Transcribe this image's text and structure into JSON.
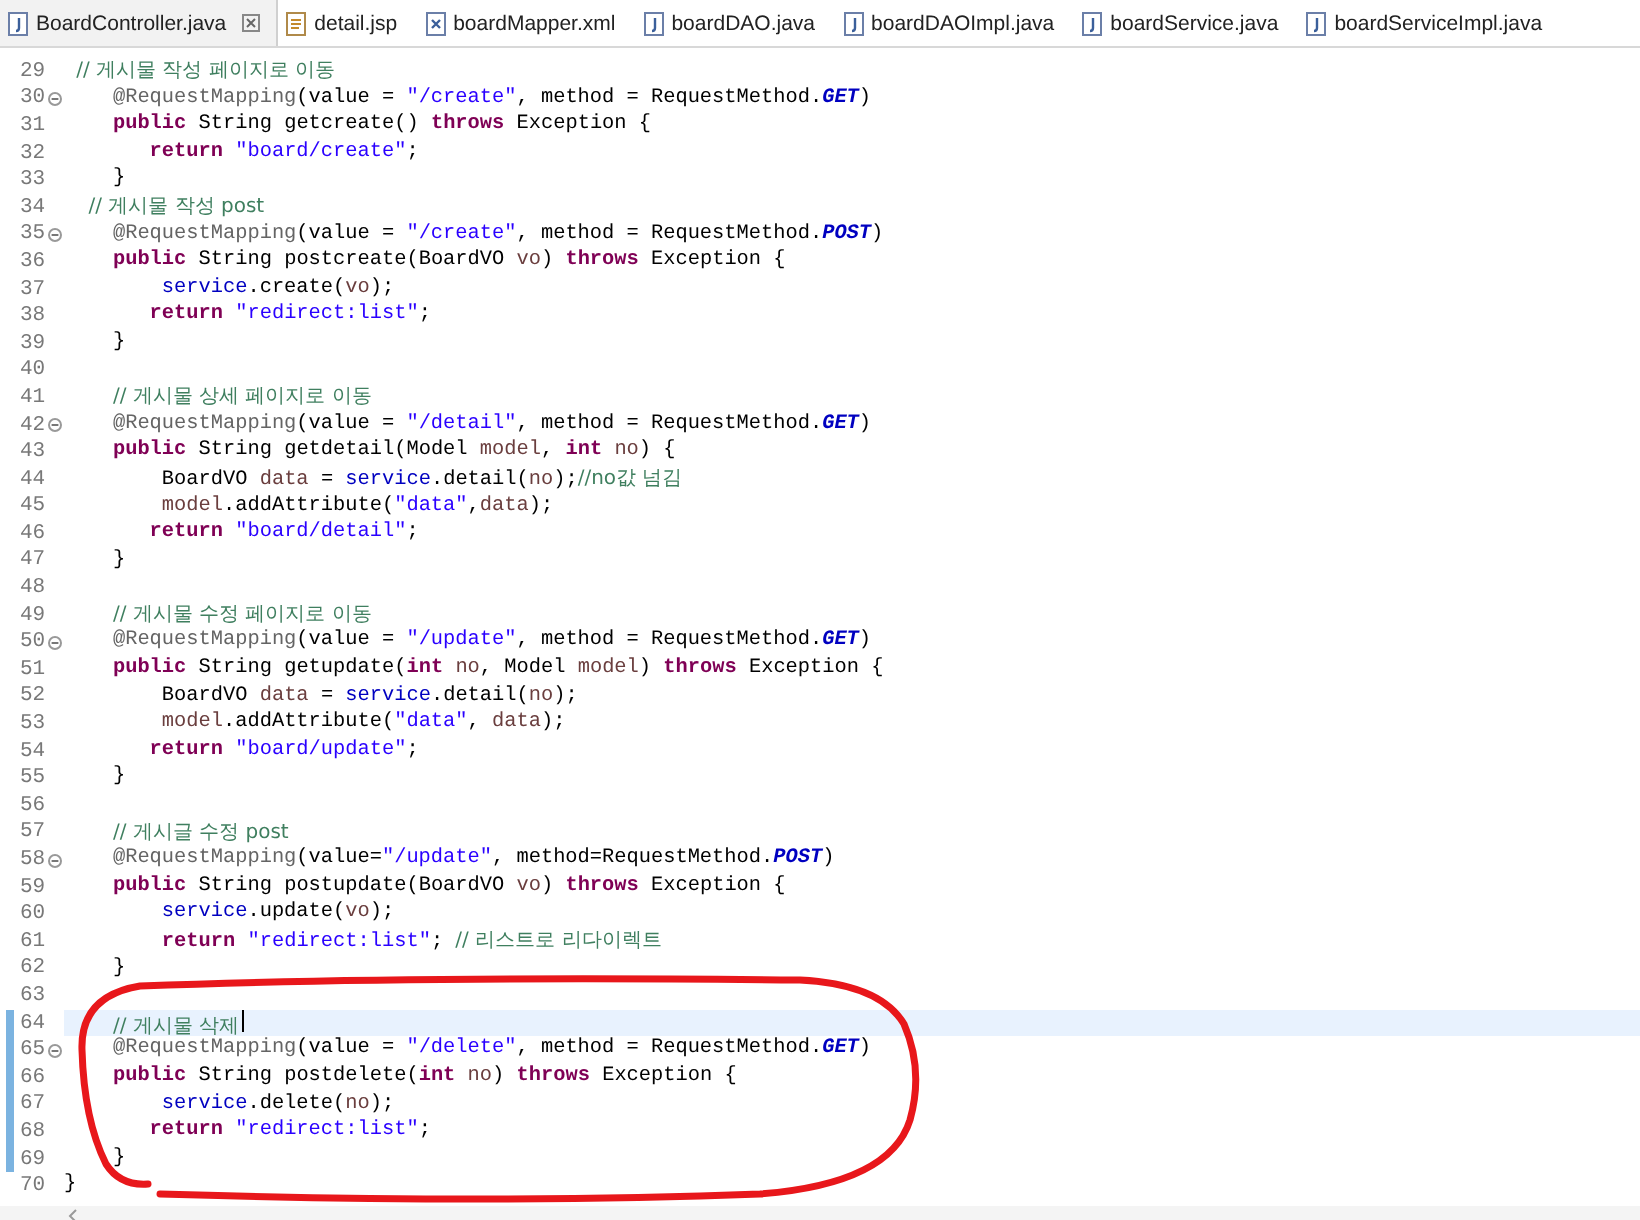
{
  "tabs": [
    {
      "label": "BoardController.java",
      "kind": "java",
      "selected": true
    },
    {
      "label": "detail.jsp",
      "kind": "jsp",
      "selected": false
    },
    {
      "label": "boardMapper.xml",
      "kind": "xml",
      "selected": false
    },
    {
      "label": "boardDAO.java",
      "kind": "java",
      "selected": false
    },
    {
      "label": "boardDAOImpl.java",
      "kind": "java",
      "selected": false
    },
    {
      "label": "boardService.java",
      "kind": "java",
      "selected": false
    },
    {
      "label": "boardServiceImpl.java",
      "kind": "java",
      "selected": false
    }
  ],
  "lines": [
    {
      "number": "29",
      "fold": false,
      "changed": false,
      "current": false,
      "tokens": [
        {
          "kind": "comment",
          "text": " // 게시물 작성 페이지로 이동"
        }
      ]
    },
    {
      "number": "30",
      "fold": true,
      "changed": false,
      "current": false,
      "tokens": [
        {
          "kind": "annotation",
          "text": "    @RequestMapping"
        },
        {
          "kind": "plain",
          "text": "(value = "
        },
        {
          "kind": "string",
          "text": "\"/create\""
        },
        {
          "kind": "plain",
          "text": ", method = RequestMethod."
        },
        {
          "kind": "constant",
          "text": "GET"
        },
        {
          "kind": "plain",
          "text": ")"
        }
      ]
    },
    {
      "number": "31",
      "fold": false,
      "changed": false,
      "current": false,
      "tokens": [
        {
          "kind": "keyword",
          "text": "    public"
        },
        {
          "kind": "plain",
          "text": " String getcreate() "
        },
        {
          "kind": "keyword",
          "text": "throws"
        },
        {
          "kind": "plain",
          "text": " Exception {"
        }
      ]
    },
    {
      "number": "32",
      "fold": false,
      "changed": false,
      "current": false,
      "tokens": [
        {
          "kind": "keyword",
          "text": "       return"
        },
        {
          "kind": "string",
          "text": " \"board/create\""
        },
        {
          "kind": "plain",
          "text": ";"
        }
      ]
    },
    {
      "number": "33",
      "fold": false,
      "changed": false,
      "current": false,
      "tokens": [
        {
          "kind": "plain",
          "text": "    }"
        }
      ]
    },
    {
      "number": "34",
      "fold": false,
      "changed": false,
      "current": false,
      "tokens": [
        {
          "kind": "comment",
          "text": "  // 게시물 작성 post"
        }
      ]
    },
    {
      "number": "35",
      "fold": true,
      "changed": false,
      "current": false,
      "tokens": [
        {
          "kind": "annotation",
          "text": "    @RequestMapping"
        },
        {
          "kind": "plain",
          "text": "(value = "
        },
        {
          "kind": "string",
          "text": "\"/create\""
        },
        {
          "kind": "plain",
          "text": ", method = RequestMethod."
        },
        {
          "kind": "constant",
          "text": "POST"
        },
        {
          "kind": "plain",
          "text": ")"
        }
      ]
    },
    {
      "number": "36",
      "fold": false,
      "changed": false,
      "current": false,
      "tokens": [
        {
          "kind": "keyword",
          "text": "    public"
        },
        {
          "kind": "plain",
          "text": " String postcreate(BoardVO "
        },
        {
          "kind": "variable",
          "text": "vo"
        },
        {
          "kind": "plain",
          "text": ") "
        },
        {
          "kind": "keyword",
          "text": "throws"
        },
        {
          "kind": "plain",
          "text": " Exception {"
        }
      ]
    },
    {
      "number": "37",
      "fold": false,
      "changed": false,
      "current": false,
      "tokens": [
        {
          "kind": "field",
          "text": "        service"
        },
        {
          "kind": "plain",
          "text": ".create("
        },
        {
          "kind": "variable",
          "text": "vo"
        },
        {
          "kind": "plain",
          "text": ");"
        }
      ]
    },
    {
      "number": "38",
      "fold": false,
      "changed": false,
      "current": false,
      "tokens": [
        {
          "kind": "keyword",
          "text": "       return"
        },
        {
          "kind": "string",
          "text": " \"redirect:list\""
        },
        {
          "kind": "plain",
          "text": ";"
        }
      ]
    },
    {
      "number": "39",
      "fold": false,
      "changed": false,
      "current": false,
      "tokens": [
        {
          "kind": "plain",
          "text": "    }"
        }
      ]
    },
    {
      "number": "40",
      "fold": false,
      "changed": false,
      "current": false
    },
    {
      "number": "41",
      "fold": false,
      "changed": false,
      "current": false,
      "tokens": [
        {
          "kind": "comment",
          "text": "    // 게시물 상세 페이지로 이동"
        }
      ]
    },
    {
      "number": "42",
      "fold": true,
      "changed": false,
      "current": false,
      "tokens": [
        {
          "kind": "annotation",
          "text": "    @RequestMapping"
        },
        {
          "kind": "plain",
          "text": "(value = "
        },
        {
          "kind": "string",
          "text": "\"/detail\""
        },
        {
          "kind": "plain",
          "text": ", method = RequestMethod."
        },
        {
          "kind": "constant",
          "text": "GET"
        },
        {
          "kind": "plain",
          "text": ")"
        }
      ]
    },
    {
      "number": "43",
      "fold": false,
      "changed": false,
      "current": false,
      "tokens": [
        {
          "kind": "keyword",
          "text": "    public"
        },
        {
          "kind": "plain",
          "text": " String getdetail(Model "
        },
        {
          "kind": "variable",
          "text": "model"
        },
        {
          "kind": "plain",
          "text": ", "
        },
        {
          "kind": "keyword",
          "text": "int"
        },
        {
          "kind": "variable",
          "text": " no"
        },
        {
          "kind": "plain",
          "text": ") {"
        }
      ]
    },
    {
      "number": "44",
      "fold": false,
      "changed": false,
      "current": false,
      "tokens": [
        {
          "kind": "plain",
          "text": "        BoardVO "
        },
        {
          "kind": "variable",
          "text": "data"
        },
        {
          "kind": "plain",
          "text": " = "
        },
        {
          "kind": "field",
          "text": "service"
        },
        {
          "kind": "plain",
          "text": ".detail("
        },
        {
          "kind": "variable",
          "text": "no"
        },
        {
          "kind": "plain",
          "text": ");"
        },
        {
          "kind": "comment",
          "text": "//no값 넘김"
        }
      ]
    },
    {
      "number": "45",
      "fold": false,
      "changed": false,
      "current": false,
      "tokens": [
        {
          "kind": "variable",
          "text": "        model"
        },
        {
          "kind": "plain",
          "text": ".addAttribute("
        },
        {
          "kind": "string",
          "text": "\"data\""
        },
        {
          "kind": "plain",
          "text": ","
        },
        {
          "kind": "variable",
          "text": "data"
        },
        {
          "kind": "plain",
          "text": ");"
        }
      ]
    },
    {
      "number": "46",
      "fold": false,
      "changed": false,
      "current": false,
      "tokens": [
        {
          "kind": "keyword",
          "text": "       return"
        },
        {
          "kind": "string",
          "text": " \"board/detail\""
        },
        {
          "kind": "plain",
          "text": ";"
        }
      ]
    },
    {
      "number": "47",
      "fold": false,
      "changed": false,
      "current": false,
      "tokens": [
        {
          "kind": "plain",
          "text": "    }"
        }
      ]
    },
    {
      "number": "48",
      "fold": false,
      "changed": false,
      "current": false
    },
    {
      "number": "49",
      "fold": false,
      "changed": false,
      "current": false,
      "tokens": [
        {
          "kind": "comment",
          "text": "    // 게시물 수정 페이지로 이동"
        }
      ]
    },
    {
      "number": "50",
      "fold": true,
      "changed": false,
      "current": false,
      "tokens": [
        {
          "kind": "annotation",
          "text": "    @RequestMapping"
        },
        {
          "kind": "plain",
          "text": "(value = "
        },
        {
          "kind": "string",
          "text": "\"/update\""
        },
        {
          "kind": "plain",
          "text": ", method = RequestMethod."
        },
        {
          "kind": "constant",
          "text": "GET"
        },
        {
          "kind": "plain",
          "text": ")"
        }
      ]
    },
    {
      "number": "51",
      "fold": false,
      "changed": false,
      "current": false,
      "tokens": [
        {
          "kind": "keyword",
          "text": "    public"
        },
        {
          "kind": "plain",
          "text": " String getupdate("
        },
        {
          "kind": "keyword",
          "text": "int"
        },
        {
          "kind": "variable",
          "text": " no"
        },
        {
          "kind": "plain",
          "text": ", Model "
        },
        {
          "kind": "variable",
          "text": "model"
        },
        {
          "kind": "plain",
          "text": ") "
        },
        {
          "kind": "keyword",
          "text": "throws"
        },
        {
          "kind": "plain",
          "text": " Exception {"
        }
      ]
    },
    {
      "number": "52",
      "fold": false,
      "changed": false,
      "current": false,
      "tokens": [
        {
          "kind": "plain",
          "text": "        BoardVO "
        },
        {
          "kind": "variable",
          "text": "data"
        },
        {
          "kind": "plain",
          "text": " = "
        },
        {
          "kind": "field",
          "text": "service"
        },
        {
          "kind": "plain",
          "text": ".detail("
        },
        {
          "kind": "variable",
          "text": "no"
        },
        {
          "kind": "plain",
          "text": ");"
        }
      ]
    },
    {
      "number": "53",
      "fold": false,
      "changed": false,
      "current": false,
      "tokens": [
        {
          "kind": "variable",
          "text": "        model"
        },
        {
          "kind": "plain",
          "text": ".addAttribute("
        },
        {
          "kind": "string",
          "text": "\"data\""
        },
        {
          "kind": "plain",
          "text": ", "
        },
        {
          "kind": "variable",
          "text": "data"
        },
        {
          "kind": "plain",
          "text": ");"
        }
      ]
    },
    {
      "number": "54",
      "fold": false,
      "changed": false,
      "current": false,
      "tokens": [
        {
          "kind": "keyword",
          "text": "       return"
        },
        {
          "kind": "string",
          "text": " \"board/update\""
        },
        {
          "kind": "plain",
          "text": ";"
        }
      ]
    },
    {
      "number": "55",
      "fold": false,
      "changed": false,
      "current": false,
      "tokens": [
        {
          "kind": "plain",
          "text": "    }"
        }
      ]
    },
    {
      "number": "56",
      "fold": false,
      "changed": false,
      "current": false
    },
    {
      "number": "57",
      "fold": false,
      "changed": false,
      "current": false,
      "tokens": [
        {
          "kind": "comment",
          "text": "    // 게시글 수정 post"
        }
      ]
    },
    {
      "number": "58",
      "fold": true,
      "changed": false,
      "current": false,
      "tokens": [
        {
          "kind": "annotation",
          "text": "    @RequestMapping"
        },
        {
          "kind": "plain",
          "text": "(value="
        },
        {
          "kind": "string",
          "text": "\"/update\""
        },
        {
          "kind": "plain",
          "text": ", method=RequestMethod."
        },
        {
          "kind": "constant",
          "text": "POST"
        },
        {
          "kind": "plain",
          "text": ")"
        }
      ]
    },
    {
      "number": "59",
      "fold": false,
      "changed": false,
      "current": false,
      "tokens": [
        {
          "kind": "keyword",
          "text": "    public"
        },
        {
          "kind": "plain",
          "text": " String postupdate(BoardVO "
        },
        {
          "kind": "variable",
          "text": "vo"
        },
        {
          "kind": "plain",
          "text": ") "
        },
        {
          "kind": "keyword",
          "text": "throws"
        },
        {
          "kind": "plain",
          "text": " Exception {"
        }
      ]
    },
    {
      "number": "60",
      "fold": false,
      "changed": false,
      "current": false,
      "tokens": [
        {
          "kind": "field",
          "text": "        service"
        },
        {
          "kind": "plain",
          "text": ".update("
        },
        {
          "kind": "variable",
          "text": "vo"
        },
        {
          "kind": "plain",
          "text": ");"
        }
      ]
    },
    {
      "number": "61",
      "fold": false,
      "changed": false,
      "current": false,
      "tokens": [
        {
          "kind": "keyword",
          "text": "        return"
        },
        {
          "kind": "string",
          "text": " \"redirect:list\""
        },
        {
          "kind": "plain",
          "text": "; "
        },
        {
          "kind": "comment",
          "text": "// 리스트로 리다이렉트"
        }
      ]
    },
    {
      "number": "62",
      "fold": false,
      "changed": false,
      "current": false,
      "tokens": [
        {
          "kind": "plain",
          "text": "    }"
        }
      ]
    },
    {
      "number": "63",
      "fold": false,
      "changed": false,
      "current": false
    },
    {
      "number": "64",
      "fold": false,
      "changed": true,
      "current": true,
      "tokens": [
        {
          "kind": "comment",
          "text": "    // 게시물 삭제"
        }
      ]
    },
    {
      "number": "65",
      "fold": true,
      "changed": true,
      "current": false,
      "tokens": [
        {
          "kind": "annotation",
          "text": "    @RequestMapping"
        },
        {
          "kind": "plain",
          "text": "(value = "
        },
        {
          "kind": "string",
          "text": "\"/delete\""
        },
        {
          "kind": "plain",
          "text": ", method = RequestMethod."
        },
        {
          "kind": "constant",
          "text": "GET"
        },
        {
          "kind": "plain",
          "text": ")"
        }
      ]
    },
    {
      "number": "66",
      "fold": false,
      "changed": true,
      "current": false,
      "tokens": [
        {
          "kind": "keyword",
          "text": "    public"
        },
        {
          "kind": "plain",
          "text": " String postdelete("
        },
        {
          "kind": "keyword",
          "text": "int"
        },
        {
          "kind": "variable",
          "text": " no"
        },
        {
          "kind": "plain",
          "text": ") "
        },
        {
          "kind": "keyword",
          "text": "throws"
        },
        {
          "kind": "plain",
          "text": " Exception {"
        }
      ]
    },
    {
      "number": "67",
      "fold": false,
      "changed": true,
      "current": false,
      "tokens": [
        {
          "kind": "field",
          "text": "        service"
        },
        {
          "kind": "plain",
          "text": ".delete("
        },
        {
          "kind": "variable",
          "text": "no"
        },
        {
          "kind": "plain",
          "text": ");"
        }
      ]
    },
    {
      "number": "68",
      "fold": false,
      "changed": true,
      "current": false,
      "tokens": [
        {
          "kind": "keyword",
          "text": "       return"
        },
        {
          "kind": "string",
          "text": " \"redirect:list\""
        },
        {
          "kind": "plain",
          "text": ";"
        }
      ]
    },
    {
      "number": "69",
      "fold": false,
      "changed": true,
      "current": false,
      "tokens": [
        {
          "kind": "plain",
          "text": "    }"
        }
      ]
    },
    {
      "number": "70",
      "fold": false,
      "changed": false,
      "current": false,
      "tokens": [
        {
          "kind": "plain",
          "text": "}"
        }
      ]
    }
  ]
}
